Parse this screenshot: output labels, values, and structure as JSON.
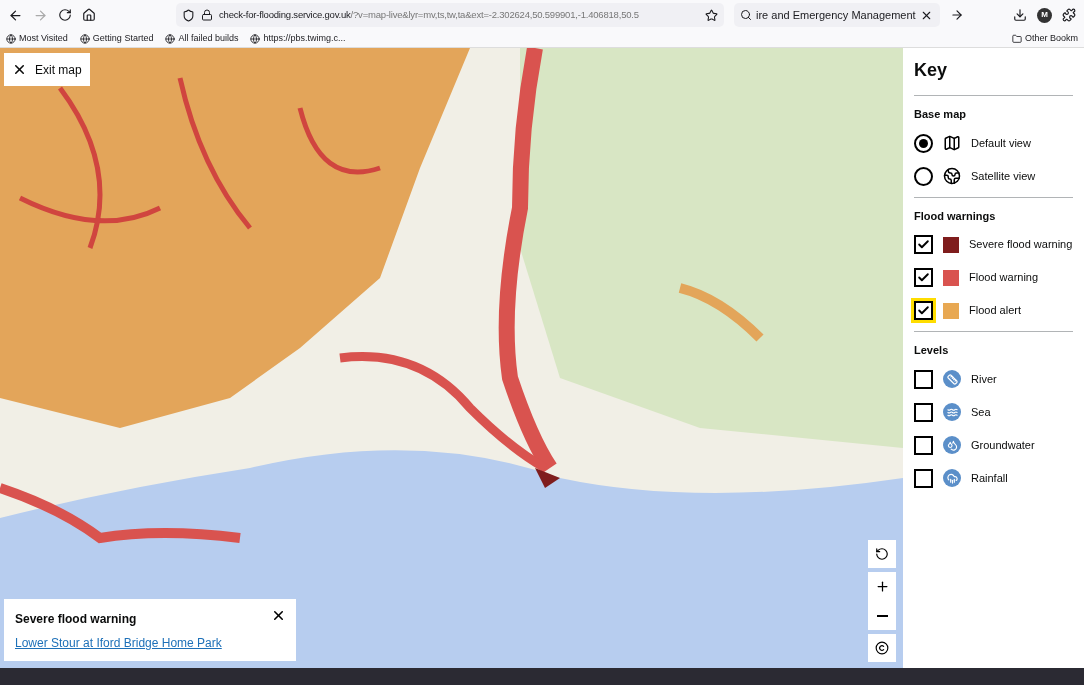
{
  "browser": {
    "url_host": "check-for-flooding.service.gov.uk",
    "url_rest": "/?v=map-live&lyr=mv,ts,tw,ta&ext=-2.302624,50.599901,-1.406818,50.5",
    "search": "ire and Emergency Management",
    "avatar": "M",
    "bookmarks": [
      "Most Visited",
      "Getting Started",
      "All failed builds",
      "https://pbs.twimg.c..."
    ],
    "other_bookmarks": "Other Bookm"
  },
  "map": {
    "exit_label": "Exit map",
    "popup": {
      "title": "Severe flood warning",
      "link": "Lower Stour at Iford Bridge Home Park"
    }
  },
  "key": {
    "title": "Key",
    "sections": [
      {
        "heading": "Base map",
        "items": [
          {
            "kind": "radio",
            "label": "Default view",
            "selected": true
          },
          {
            "kind": "radio",
            "label": "Satellite view",
            "selected": false
          }
        ]
      },
      {
        "heading": "Flood warnings",
        "items": [
          {
            "kind": "checkbox",
            "label": "Severe flood warning",
            "checked": true,
            "focused": false,
            "color": "#7f1d1d"
          },
          {
            "kind": "checkbox",
            "label": "Flood warning",
            "checked": true,
            "focused": false,
            "color": "#d9534f"
          },
          {
            "kind": "checkbox",
            "label": "Flood alert",
            "checked": true,
            "focused": true,
            "color": "#e8a852"
          }
        ]
      },
      {
        "heading": "Levels",
        "items": [
          {
            "kind": "checkbox",
            "label": "River",
            "checked": false,
            "focused": false
          },
          {
            "kind": "checkbox",
            "label": "Sea",
            "checked": false,
            "focused": false
          },
          {
            "kind": "checkbox",
            "label": "Groundwater",
            "checked": false,
            "focused": false
          },
          {
            "kind": "checkbox",
            "label": "Rainfall",
            "checked": false,
            "focused": false
          }
        ]
      }
    ]
  }
}
